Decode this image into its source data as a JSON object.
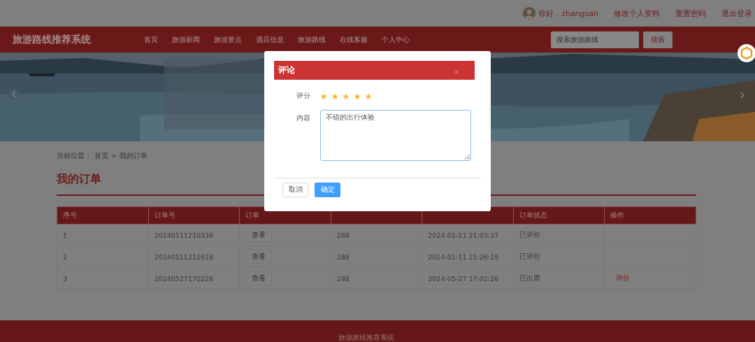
{
  "top_bar": {
    "greeting": "你好，zhangsan",
    "links": [
      "修改个人资料",
      "重置密码",
      "退出登录"
    ]
  },
  "nav": {
    "logo": "旅游路线推荐系统",
    "items": [
      {
        "label": "首页",
        "selected": false
      },
      {
        "label": "旅游新闻",
        "selected": false
      },
      {
        "label": "旅游景点",
        "selected": false
      },
      {
        "label": "酒店信息",
        "selected": false
      },
      {
        "label": "旅游路线",
        "selected": false
      },
      {
        "label": "在线客服",
        "selected": false
      },
      {
        "label": "个人中心",
        "selected": false
      }
    ],
    "search": {
      "placeholder": "搜索旅游路线",
      "button": "搜索"
    }
  },
  "breadcrumb": {
    "prefix": "当前位置：",
    "items": [
      "首页",
      "我的订单"
    ],
    "separator": ">"
  },
  "page_title": "我的订单",
  "table": {
    "columns": [
      {
        "label": "序号"
      },
      {
        "label": "订单号"
      },
      {
        "label": "订单"
      },
      {},
      {},
      {
        "label": "订单状态"
      },
      {
        "label": "操作"
      }
    ],
    "rows": [
      {
        "index": "1",
        "order_no": "20240111210336",
        "detail_button": "查看",
        "amount": "288",
        "time": "2024-01-11 21:03:37",
        "status": "已评价"
      },
      {
        "index": "2",
        "order_no": "20240111212618",
        "detail_button": "查看",
        "amount": "288",
        "time": "2024-01-11 21:26:19",
        "status": "已评价"
      },
      {
        "index": "3",
        "order_no": "20240527170226",
        "detail_button": "查看",
        "amount": "288",
        "time": "2024-05-27 17:02:26",
        "status": "已出票",
        "action": "评价"
      }
    ]
  },
  "footer": {
    "title": "旅游路线推荐系统"
  },
  "dialog": {
    "title": "评论",
    "rating_label": "评分",
    "stars": 5,
    "content_label": "内容",
    "content": "不错的出行体验",
    "buttons": [
      {
        "label": "取消",
        "kind": "default"
      },
      {
        "label": "确定",
        "kind": "primary"
      }
    ]
  }
}
